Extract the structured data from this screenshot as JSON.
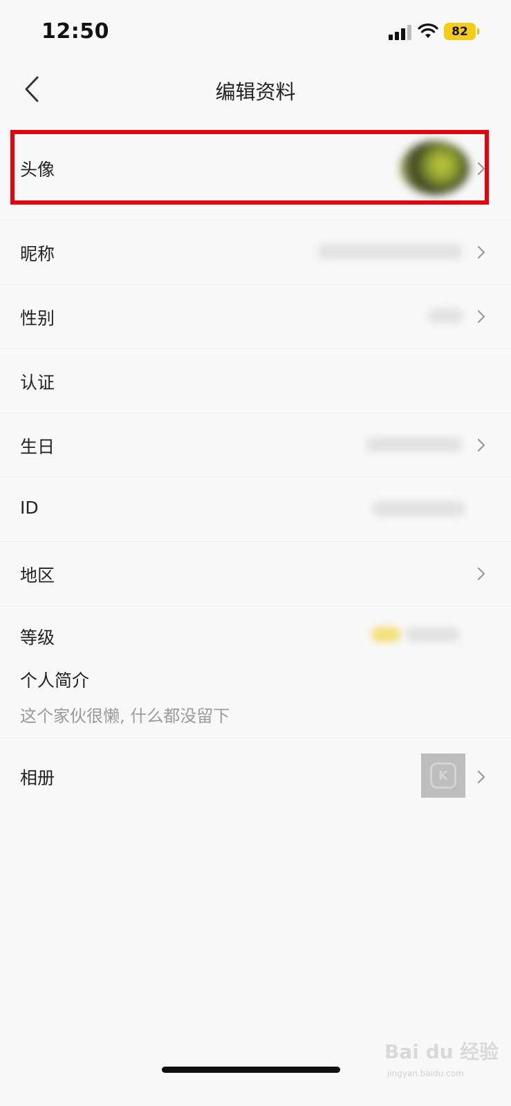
{
  "status_bar": {
    "time": "12:50",
    "battery": "82"
  },
  "nav": {
    "title": "编辑资料"
  },
  "rows": {
    "avatar": {
      "label": "头像"
    },
    "nickname": {
      "label": "昵称"
    },
    "gender": {
      "label": "性别"
    },
    "verify": {
      "label": "认证"
    },
    "birthday": {
      "label": "生日"
    },
    "id": {
      "label": "ID"
    },
    "region": {
      "label": "地区"
    },
    "level": {
      "label": "等级"
    },
    "bio": {
      "label": "个人简介",
      "value": "这个家伙很懒, 什么都没留下"
    },
    "album": {
      "label": "相册"
    }
  },
  "watermark": {
    "text": "Bai du 经验",
    "sub": "jingyan.baidu.com"
  },
  "colors": {
    "highlight": "#e8000b",
    "battery": "#f5cc16"
  }
}
